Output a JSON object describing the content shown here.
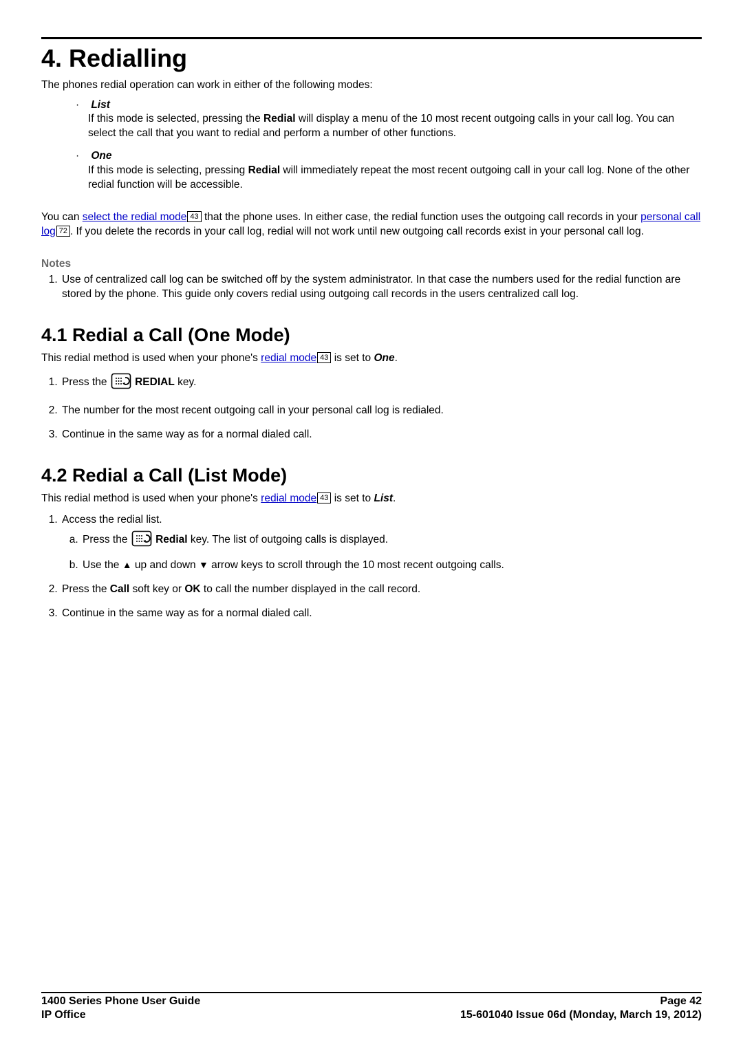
{
  "chapter": {
    "title": "4. Redialling"
  },
  "intro": "The phones redial operation can work in either of the following modes:",
  "bullets": {
    "list": {
      "head": "List",
      "body_a": "If this mode is selected, pressing the ",
      "redial_b": "Redial",
      "body_b": " will display a menu of the 10 most recent outgoing calls in your call log. You can select the call that you want to redial and perform a number of other functions."
    },
    "one": {
      "head": "One",
      "body_a": "If this mode is selecting, pressing ",
      "redial_b": "Redial",
      "body_b": " will immediately repeat the most recent outgoing call in your call log. None of the other redial function will be accessible."
    }
  },
  "para2": {
    "a": "You can ",
    "link1": "select the redial mode",
    "ref1": "43",
    "b": " that the phone uses. In either case, the redial function uses the outgoing call records in your ",
    "link2": "personal call log",
    "ref2": "72",
    "c": ". If you delete the records in your call log, redial will not work until new outgoing call records exist in your personal call log."
  },
  "notes": {
    "head": "Notes",
    "item1": "Use of centralized call log can be switched off by the system administrator. In that case the numbers used for the redial function are stored by the phone. This guide only covers redial using outgoing call records in the users centralized call log."
  },
  "s41": {
    "title": "4.1 Redial a Call (One Mode)",
    "intro_a": "This redial method is used when your phone's ",
    "link": "redial mode",
    "ref": "43",
    "intro_b": " is set to ",
    "mode": "One",
    "intro_c": ".",
    "step1_a": "Press the ",
    "step1_key": " REDIAL",
    "step1_b": " key.",
    "step2": "The number for the most recent outgoing call in your personal call log is redialed.",
    "step3": "Continue in the same way as for a normal dialed call."
  },
  "s42": {
    "title": "4.2 Redial a Call (List Mode)",
    "intro_a": "This redial method is used when your phone's ",
    "link": "redial mode",
    "ref": "43",
    "intro_b": " is set to ",
    "mode": "List",
    "intro_c": ".",
    "step1": "Access the redial list.",
    "step1a_a": "Press the ",
    "step1a_key": " Redial",
    "step1a_b": " key. The list of outgoing calls is displayed.",
    "step1b_a": "Use the ",
    "step1b_b": " up and down ",
    "step1b_c": " arrow keys to scroll through the 10 most recent outgoing calls.",
    "step2_a": "Press the ",
    "step2_call": "Call",
    "step2_b": " soft key or ",
    "step2_ok": "OK",
    "step2_c": " to call the number displayed in the call record.",
    "step3": "Continue in the same way as for a normal dialed call."
  },
  "footer": {
    "left1": "1400 Series Phone User Guide",
    "right1": "Page 42",
    "left2": "IP Office",
    "right2": "15-601040 Issue 06d (Monday, March 19, 2012)"
  },
  "icons": {
    "redial_key": "redial-key-icon",
    "up_arrow": "▲",
    "down_arrow": "▼"
  }
}
